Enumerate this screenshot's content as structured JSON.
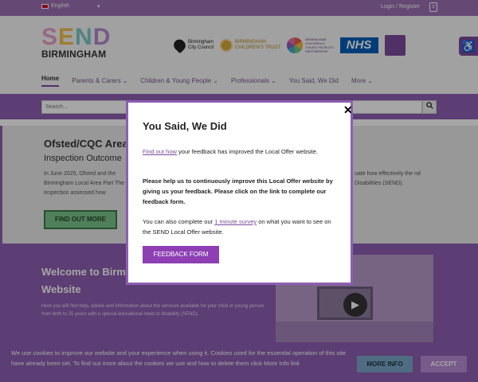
{
  "topbar": {
    "language": "English",
    "language_caret": "▾",
    "login": "Login / Register",
    "cart_count": "0"
  },
  "header": {
    "logo_top": [
      "S",
      "E",
      "N",
      "D"
    ],
    "logo_bottom": "BIRMINGHAM",
    "partners": {
      "bcc": [
        "Birmingham",
        "City Council"
      ],
      "bct": [
        "BIRMINGHAM",
        "CHILDREN'S TRUST"
      ],
      "bcy": [
        "BIRMINGHAM",
        "CHILDREN &",
        "YOUNG PEOPLE'S",
        "PARTNERSHIP"
      ],
      "nhs": "NHS"
    },
    "accessibility_icon": "accessibility-icon"
  },
  "nav": {
    "items": [
      {
        "label": "Home",
        "caret": ""
      },
      {
        "label": "Parents & Carers",
        "caret": "⌄"
      },
      {
        "label": "Children & Young People",
        "caret": "⌄"
      },
      {
        "label": "Professionals",
        "caret": "⌄"
      },
      {
        "label": "You Said, We Did",
        "caret": ""
      },
      {
        "label": "More",
        "caret": "⌄"
      }
    ]
  },
  "search": {
    "placeholder": "Search...",
    "button_icon": "search-icon"
  },
  "ofsted": {
    "title": "Ofsted/CQC Area",
    "subtitle": "Inspection Outcome",
    "text_left": "In June 2025, Ofsted and the Birmingham Local Area Part The inspection assessed how",
    "text_right": "uate how effectively the nd Disabilities (SEND).",
    "button": "FIND OUT MORE"
  },
  "welcome": {
    "title": "Welcome to Birm Website",
    "text": "Here you will find help, advice and information about the services available for your child or young person from birth to 25 years with a special educational need or disability (SEND)."
  },
  "cookie": {
    "text": "We use cookies to improve our website and your experience when using it. Cookies used for the essential operation of this site have already been set. To find out more about the cookies we use and how to delete them click More Info link",
    "more_info": "MORE INFO",
    "accept": "ACCEPT"
  },
  "modal": {
    "close": "✕",
    "title": "You Said, We Did",
    "p1_link": "Find out how",
    "p1_rest": " your feedback has improved the Local Offer website.",
    "p2": "Please help us to continuously improve this Local Offer website by giving us your feedback. Please click on the link to complete our feedback form.",
    "p3_before": "You can also complete our ",
    "p3_link": "1 minute survey",
    "p3_after": " on what you want to see on the SEND Local Offer website.",
    "button": "FEEDBACK FORM"
  },
  "colors": {
    "brand_purple": "#8e5fb3",
    "dark_purple": "#7b4a9c",
    "green_button": "#7bc58a",
    "nhs_blue": "#005eb8"
  }
}
